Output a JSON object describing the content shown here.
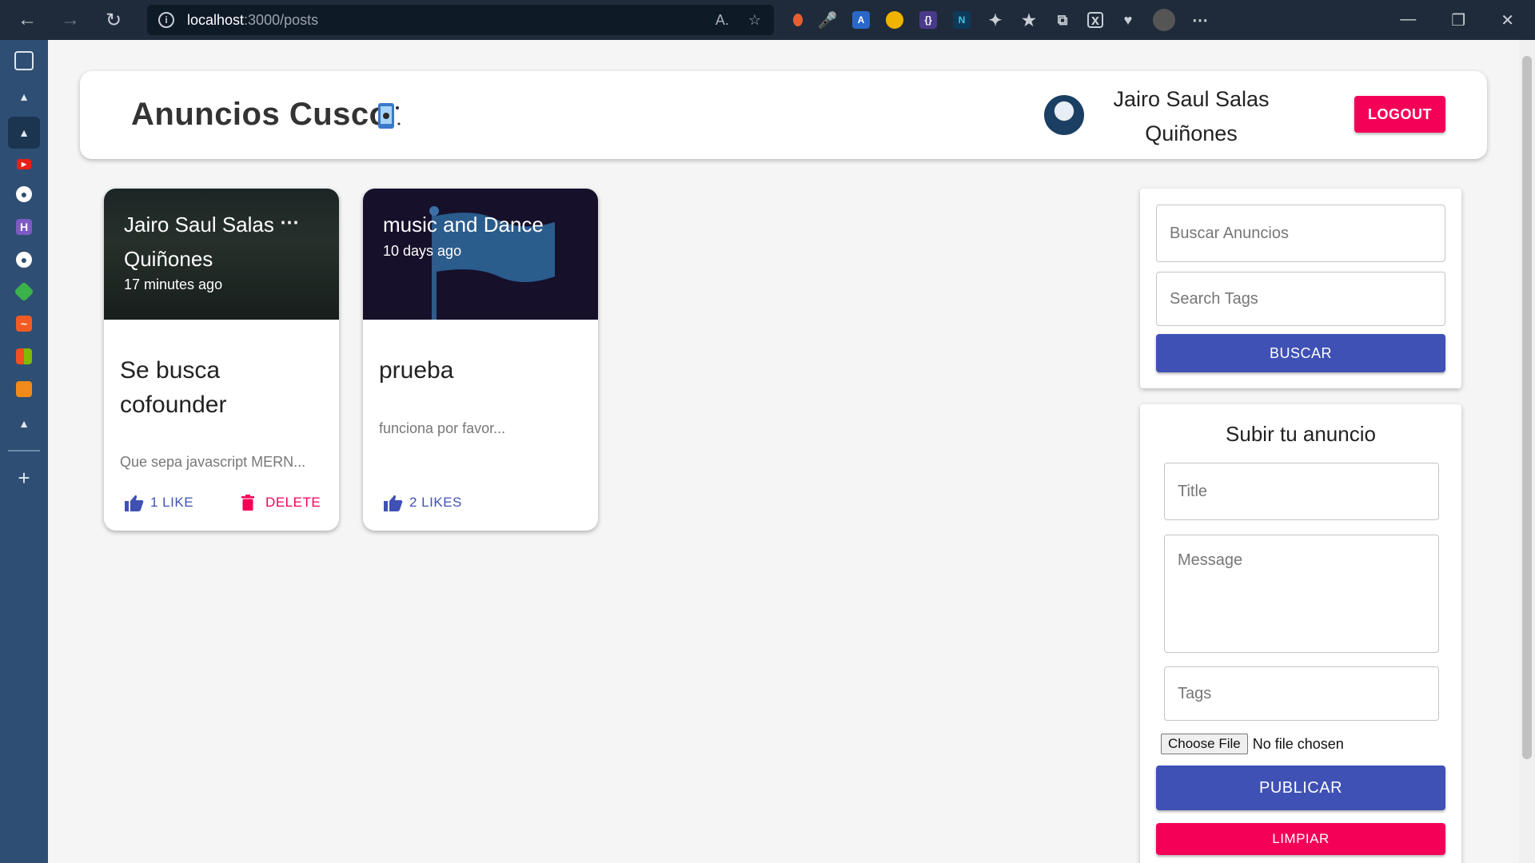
{
  "browser": {
    "url_host": "localhost",
    "url_path": ":3000/posts"
  },
  "header": {
    "brand": "Anuncios Cusco",
    "user_name": "Jairo Saul Salas Quiñones",
    "logout_label": "LOGOUT"
  },
  "posts": [
    {
      "author": "Jairo Saul Salas Quiñones",
      "time": "17 minutes ago",
      "title": "Se busca cofounder",
      "message": "Que sepa javascript MERN...",
      "like_label": "1 LIKE",
      "delete_label": "DELETE"
    },
    {
      "author": "music and Dance",
      "time": "10 days ago",
      "title": "prueba",
      "message": "funciona por favor...",
      "like_label": "2 LIKES"
    }
  ],
  "search": {
    "search_placeholder": "Buscar Anuncios",
    "tags_placeholder": "Search Tags",
    "button_label": "BUSCAR"
  },
  "form": {
    "title": "Subir tu anuncio",
    "title_placeholder": "Title",
    "message_placeholder": "Message",
    "tags_placeholder": "Tags",
    "file_button": "Choose File",
    "file_status": "No file chosen",
    "submit_label": "PUBLICAR",
    "clear_label": "LIMPIAR"
  },
  "colors": {
    "primary": "#3f51b5",
    "secondary": "#f50057"
  }
}
